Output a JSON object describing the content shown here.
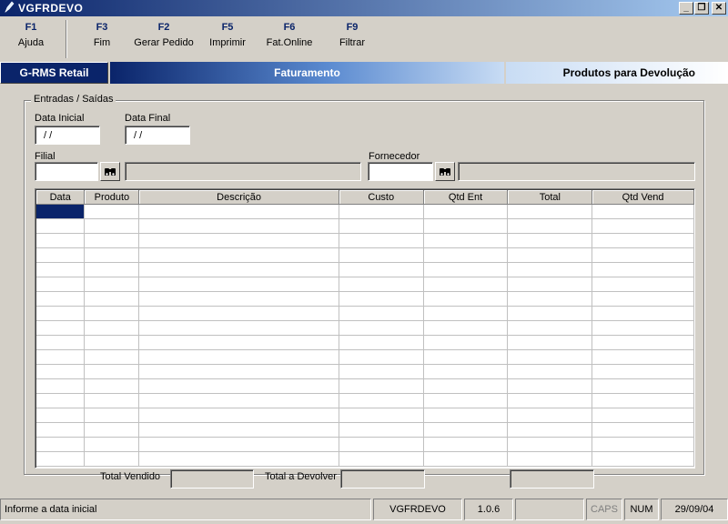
{
  "window": {
    "title": "VGFRDEVO",
    "controls": [
      "_",
      "❐",
      "✕"
    ]
  },
  "toolbar": [
    {
      "key": "F1",
      "label": "Ajuda"
    },
    {
      "key": "F3",
      "label": "Fim"
    },
    {
      "key": "F2",
      "label": "Gerar Pedido"
    },
    {
      "key": "F5",
      "label": "Imprimir"
    },
    {
      "key": "F6",
      "label": "Fat.Online"
    },
    {
      "key": "F9",
      "label": "Filtrar"
    }
  ],
  "module_bar": {
    "app": "G-RMS Retail",
    "module": "Faturamento",
    "screen": "Produtos para Devolução"
  },
  "form": {
    "group_title": "Entradas / Saídas",
    "data_inicial_label": "Data Inicial",
    "data_inicial_value": " / /",
    "data_final_label": "Data Final",
    "data_final_value": " / /",
    "filial_label": "Filial",
    "filial_value": "",
    "fornecedor_label": "Fornecedor",
    "fornecedor_value": ""
  },
  "grid": {
    "columns": [
      "Data",
      "Produto",
      "Descrição",
      "Custo",
      "Qtd Ent",
      "Total",
      "Qtd Vend"
    ],
    "rows": []
  },
  "totals": {
    "total_vendido_label": "Total Vendido",
    "total_vendido_value": "",
    "total_devolver_label": "Total a Devolver",
    "total_devolver_value": "",
    "extra_value": ""
  },
  "statusbar": {
    "message": "Informe a data inicial",
    "program": "VGFRDEVO",
    "version": "1.0.6",
    "blank": "",
    "caps": "CAPS",
    "num": "NUM",
    "date": "29/09/04"
  },
  "icons": {
    "app": "pen-icon",
    "search": "binoculars-icon"
  },
  "colors": {
    "title_dark": "#0a246a",
    "title_light": "#a6caf0",
    "face": "#d4d0c8",
    "selection": "#0a246a"
  }
}
